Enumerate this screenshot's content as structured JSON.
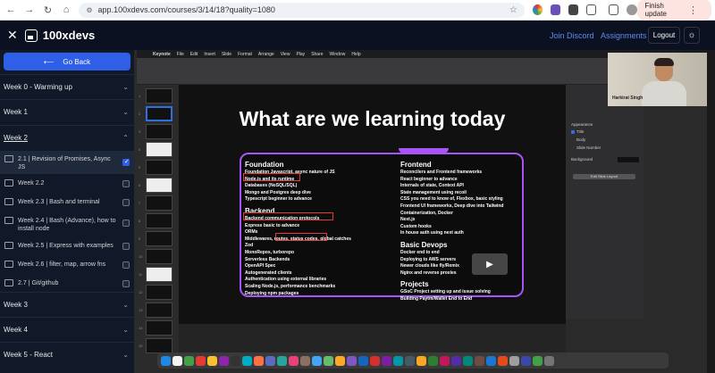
{
  "browser": {
    "url": "app.100xdevs.com/courses/3/14/18?quality=1080",
    "finish_update": "Finish update"
  },
  "topbar": {
    "brand": "100xdevs",
    "join_discord": "Join Discord",
    "assignments": "Assignments",
    "logout": "Logout"
  },
  "sidebar": {
    "back": "Go Back",
    "weeks": [
      {
        "label": "Week 0 - Warming up"
      },
      {
        "label": "Week 1"
      },
      {
        "label": "Week 2"
      },
      {
        "label": "Week 3"
      },
      {
        "label": "Week 4"
      },
      {
        "label": "Week 5 - React"
      }
    ],
    "subitems": [
      {
        "label": "2.1 | Revision of Promises, Async JS",
        "checked": true
      },
      {
        "label": "Week 2.2",
        "checked": false
      },
      {
        "label": "Week 2.3 | Bash and terminal",
        "checked": false
      },
      {
        "label": "Week 2.4 | Bash (Advance), how to install node",
        "checked": false
      },
      {
        "label": "Week 2.5 | Express with examples",
        "checked": false
      },
      {
        "label": "Week 2.6 | filter, map, arrow fns",
        "checked": false
      },
      {
        "label": "2.7 | Git/github",
        "checked": false
      }
    ]
  },
  "keynote": {
    "menu": [
      "Keynote",
      "File",
      "Edit",
      "Insert",
      "Slide",
      "Format",
      "Arrange",
      "View",
      "Play",
      "Share",
      "Window",
      "Help"
    ],
    "slide_numbers": [
      "1",
      "2",
      "3",
      "4",
      "5",
      "6",
      "7",
      "8",
      "9",
      "10",
      "11",
      "12",
      "13",
      "14",
      "15"
    ],
    "inspector": {
      "appearance": "Appearance",
      "title": "Title",
      "body": "Body",
      "slide_number": "Slide Number",
      "background": "Background",
      "edit_layout": "Edit Slide Layout"
    },
    "camera_name": "Harkirat Singh"
  },
  "slide": {
    "title": "What are we learning today",
    "left": {
      "foundation_h": "Foundation",
      "foundation": [
        "Foundation Javascript, async nature of JS",
        "Node.js and its runtime",
        "Databases (NoSQL/SQL)",
        "Mongo and Postgres deep dive",
        "Typescript beginner to advance"
      ],
      "backend_h": "Backend",
      "backend": [
        "Backend communication protocols",
        "Express basic to advance",
        "ORMs",
        "Middlewares, routes, status codes, global catches",
        "Zod",
        "MonoRepos, turborepo",
        "Serverless Backends",
        "OpenAPI Spec",
        "Autogenerated clients",
        "Authentication using external libraries",
        "Scaling Node.js, performance benchmarks",
        "Deploying npm packages"
      ]
    },
    "right": {
      "frontend_h": "Frontend",
      "frontend": [
        "Reconcilers and Frontend frameworks",
        "React beginner to advance",
        "Internals of state, Context API",
        "State management using recoil",
        "CSS you need to know of, Flexbox, basic styling",
        "Frontend UI frameworks, Deep dive into Tailwind",
        "Containerization, Docker",
        "Next.js",
        "Custom hooks",
        "In house auth using next auth"
      ],
      "devops_h": "Basic Devops",
      "devops": [
        "Docker end to end",
        "Deploying to AWS servers",
        "Newer clouds like fly/Remix",
        "Nginx and reverse proxies"
      ],
      "projects_h": "Projects",
      "projects": [
        "GSoC Project setting up and issue solving",
        "Building Paytm/Wallet End to End"
      ]
    }
  }
}
